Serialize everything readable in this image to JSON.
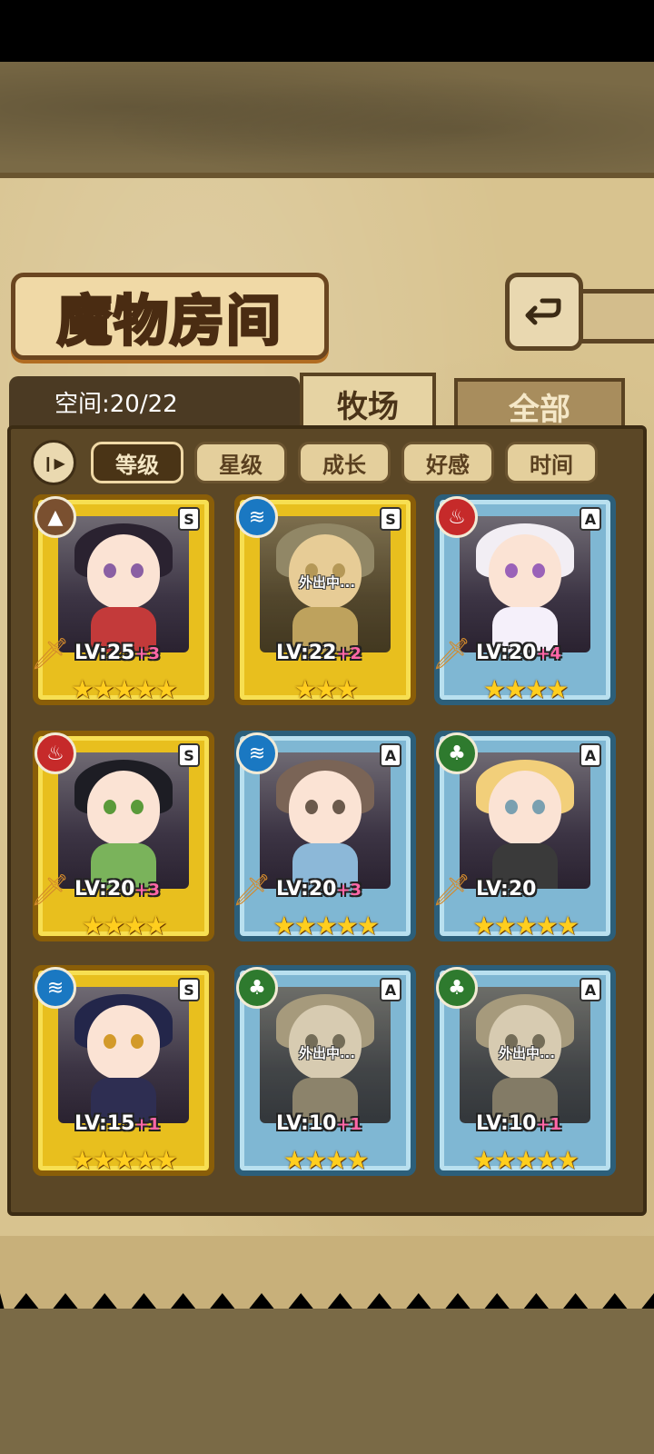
{
  "title": "魔物房间",
  "space": {
    "label": "空间:20/22"
  },
  "tabs": [
    {
      "label": "牧场",
      "active": true
    },
    {
      "label": "全部",
      "active": false
    }
  ],
  "sort": {
    "toggle_icon": "pause-sort-icon",
    "buttons": [
      {
        "label": "等级",
        "active": true
      },
      {
        "label": "星级",
        "active": false
      },
      {
        "label": "成长",
        "active": false
      },
      {
        "label": "好感",
        "active": false
      },
      {
        "label": "时间",
        "active": false
      }
    ]
  },
  "monsters": [
    {
      "element": "earth",
      "element_glyph": "▲",
      "element_color": "#7a5030",
      "rank": "S",
      "frame": "gold",
      "level": "LV:25",
      "bonus": "+3",
      "stars": "★★★★★",
      "away": "",
      "has_sword": true,
      "hair": "#2a2230",
      "body": "#c33a3a",
      "eye": "#8a5fa3"
    },
    {
      "element": "water",
      "element_glyph": "≋",
      "element_color": "#1a78c2",
      "rank": "S",
      "frame": "gold",
      "level": "LV:22",
      "bonus": "+2",
      "stars": "★★★",
      "away": "外出中...",
      "has_sword": false,
      "hair": "#7c8ea2",
      "body": "#d7b252",
      "eye": "#d2a24a"
    },
    {
      "element": "fire",
      "element_glyph": "♨",
      "element_color": "#c62a2a",
      "rank": "A",
      "frame": "blue",
      "level": "LV:20",
      "bonus": "+4",
      "stars": "★★★★",
      "away": "",
      "has_sword": true,
      "hair": "#f2eef4",
      "body": "#f5f0fa",
      "eye": "#9a62b8"
    },
    {
      "element": "fire",
      "element_glyph": "♨",
      "element_color": "#c62a2a",
      "rank": "S",
      "frame": "gold",
      "level": "LV:20",
      "bonus": "+3",
      "stars": "★★★★",
      "away": "",
      "has_sword": true,
      "hair": "#1d1d24",
      "body": "#7ab35b",
      "eye": "#5a9a3a"
    },
    {
      "element": "water",
      "element_glyph": "≋",
      "element_color": "#1a78c2",
      "rank": "A",
      "frame": "blue",
      "level": "LV:20",
      "bonus": "+3",
      "stars": "★★★★★",
      "away": "",
      "has_sword": true,
      "hair": "#7a6456",
      "body": "#8cb8d8",
      "eye": "#6b5a4c"
    },
    {
      "element": "grass",
      "element_glyph": "♣",
      "element_color": "#2e7a2e",
      "rank": "A",
      "frame": "blue",
      "level": "LV:20",
      "bonus": "",
      "stars": "★★★★★",
      "away": "",
      "has_sword": true,
      "hair": "#f2cf7a",
      "body": "#3a3a3a",
      "eye": "#7aa0b0"
    },
    {
      "element": "water",
      "element_glyph": "≋",
      "element_color": "#1a78c2",
      "rank": "S",
      "frame": "gold",
      "level": "LV:15",
      "bonus": "+1",
      "stars": "★★★★★",
      "away": "",
      "has_sword": false,
      "hair": "#23264a",
      "body": "#2e2e52",
      "eye": "#d39a2a"
    },
    {
      "element": "grass",
      "element_glyph": "♣",
      "element_color": "#2e7a2e",
      "rank": "A",
      "frame": "blue",
      "level": "LV:10",
      "bonus": "+1",
      "stars": "★★★★",
      "away": "外出中...",
      "has_sword": false,
      "hair": "#c8a76a",
      "body": "#a88656",
      "eye": "#8a6a3a"
    },
    {
      "element": "grass",
      "element_glyph": "♣",
      "element_color": "#2e7a2e",
      "rank": "A",
      "frame": "blue",
      "level": "LV:10",
      "bonus": "+1",
      "stars": "★★★★★",
      "away": "外出中...",
      "has_sword": false,
      "hair": "#c8a76a",
      "body": "#9a7c54",
      "eye": "#8a6a3a"
    }
  ]
}
